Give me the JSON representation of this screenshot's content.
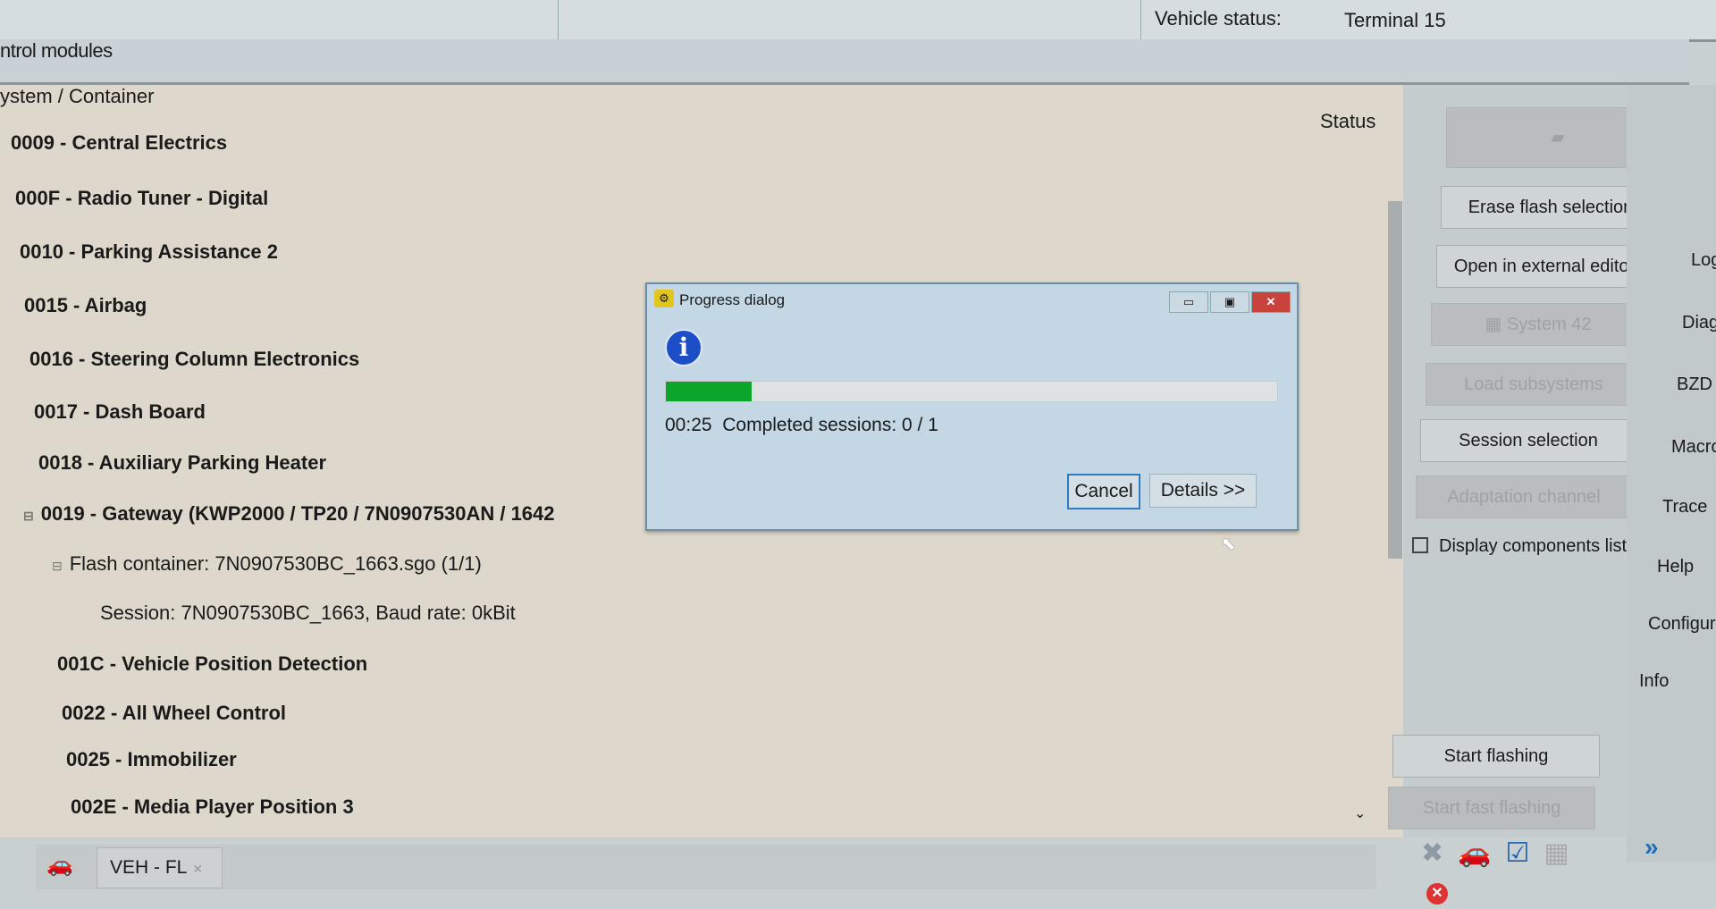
{
  "header": {
    "vehicle_status_label": "Vehicle status:",
    "vehicle_status_value": "Terminal 15",
    "section_title": "ntrol modules"
  },
  "list": {
    "column_system": "ystem / Container",
    "column_status": "Status",
    "rows": [
      {
        "label": "0009 - Central Electrics"
      },
      {
        "label": "000F - Radio Tuner - Digital"
      },
      {
        "label": "0010 - Parking Assistance 2"
      },
      {
        "label": "0015 - Airbag"
      },
      {
        "label": "0016 - Steering Column Electronics"
      },
      {
        "label": "0017 - Dash Board"
      },
      {
        "label": "0018 - Auxiliary Parking Heater"
      },
      {
        "label": "0019 - Gateway  (KWP2000 / TP20 / 7N0907530AN / 1642"
      },
      {
        "label": "Flash container: 7N0907530BC_1663.sgo (1/1)"
      },
      {
        "label": "Session: 7N0907530BC_1663, Baud rate: 0kBit"
      },
      {
        "label": "001C - Vehicle Position Detection"
      },
      {
        "label": "0022 - All Wheel Control"
      },
      {
        "label": "0025 - Immobilizer"
      },
      {
        "label": "002E - Media Player Position 3"
      }
    ]
  },
  "actions": {
    "erase_flash_selection": "Erase flash selection",
    "open_external_editor": "Open in external editor",
    "system42": "System 42",
    "load_subsystems": "Load subsystems",
    "session_selection": "Session selection",
    "adaptation_channel": "Adaptation channel",
    "display_components_list": "Display components list",
    "display_components_checked": false,
    "start_flashing": "Start flashing",
    "start_fast_flashing": "Start fast flashing"
  },
  "nav": {
    "items": [
      "Log",
      "Diag",
      "BZD",
      "Macro",
      "Trace",
      "Help",
      "Configura",
      "Info"
    ]
  },
  "tabs": [
    {
      "label": "VEH - FL"
    }
  ],
  "dialog": {
    "title": "Progress dialog",
    "progress_percent": 14,
    "elapsed": "00:25",
    "status_text": "Completed sessions: 0 / 1",
    "cancel": "Cancel",
    "details": "Details >>",
    "progress_color": "#0aa52a"
  }
}
